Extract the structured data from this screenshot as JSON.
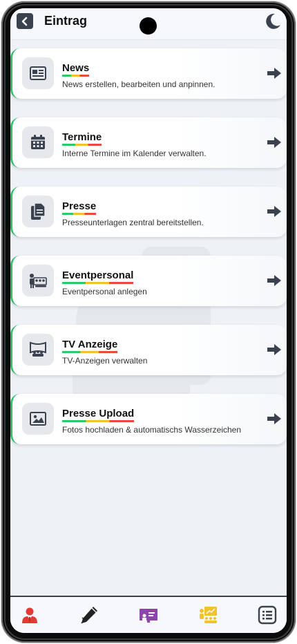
{
  "header": {
    "title": "Eintrag"
  },
  "cards": [
    {
      "title": "News",
      "subtitle": "News erstellen, bearbeiten und anpinnen.",
      "icon": "newspaper-icon"
    },
    {
      "title": "Termine",
      "subtitle": "Interne Termine im Kalender verwalten.",
      "icon": "calendar-icon"
    },
    {
      "title": "Presse",
      "subtitle": "Presseunterlagen zentral bereitstellen.",
      "icon": "document-icon"
    },
    {
      "title": "Eventpersonal",
      "subtitle": "Eventpersonal anlegen",
      "icon": "staff-group-icon"
    },
    {
      "title": "TV Anzeige",
      "subtitle": "TV-Anzeigen verwalten",
      "icon": "tv-presentation-icon"
    },
    {
      "title": "Presse Upload",
      "subtitle": "Fotos hochladen & automatischs Wasserzeichen",
      "icon": "image-upload-icon"
    }
  ],
  "bottom_nav": [
    {
      "icon": "user-icon",
      "color": "#e53935"
    },
    {
      "icon": "pen-icon",
      "color": "#222222"
    },
    {
      "icon": "presentation-board-icon",
      "color": "#8e44ad"
    },
    {
      "icon": "audience-chart-icon",
      "color": "#f2c12e"
    },
    {
      "icon": "list-icon",
      "color": "#3a4250"
    }
  ],
  "colors": {
    "accent_green": "#2ebf6a",
    "underline_green": "#2ec86a",
    "underline_yellow": "#f2c12e",
    "underline_red": "#e84a3c",
    "icon_dark": "#3a4250",
    "background": "#eef1f6"
  }
}
